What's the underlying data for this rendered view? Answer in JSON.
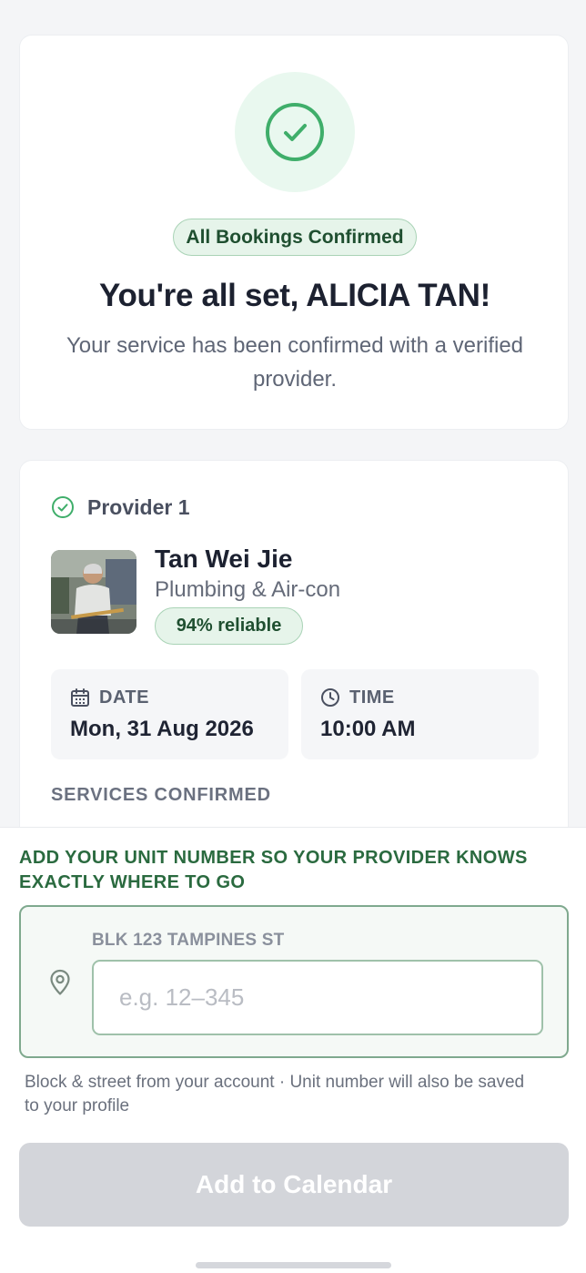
{
  "confirmation": {
    "status_pill": "All Bookings Confirmed",
    "title": "You're all set, ALICIA TAN!",
    "subtitle": "Your service has been confirmed with a verified provider.",
    "icon": "check-circle-icon"
  },
  "provider": {
    "heading": "Provider 1",
    "name": "Tan Wei Jie",
    "category": "Plumbing & Air-con",
    "reliability": "94% reliable",
    "date_label": "DATE",
    "date_value": "Mon, 31 Aug 2026",
    "time_label": "TIME",
    "time_value": "10:00 AM",
    "services_label": "SERVICES CONFIRMED"
  },
  "address": {
    "heading": "ADD YOUR UNIT NUMBER SO YOUR PROVIDER KNOWS EXACTLY WHERE TO GO",
    "street": "BLK 123 TAMPINES ST",
    "unit_value": "",
    "unit_placeholder": "e.g. 12–345",
    "helper": "Block & street from your account · Unit number will also be saved to your profile"
  },
  "actions": {
    "add_to_calendar": "Add to Calendar"
  },
  "colors": {
    "accent_green": "#2f9e5c",
    "pill_bg": "#e6f4ea",
    "button_disabled": "#d3d5da"
  }
}
